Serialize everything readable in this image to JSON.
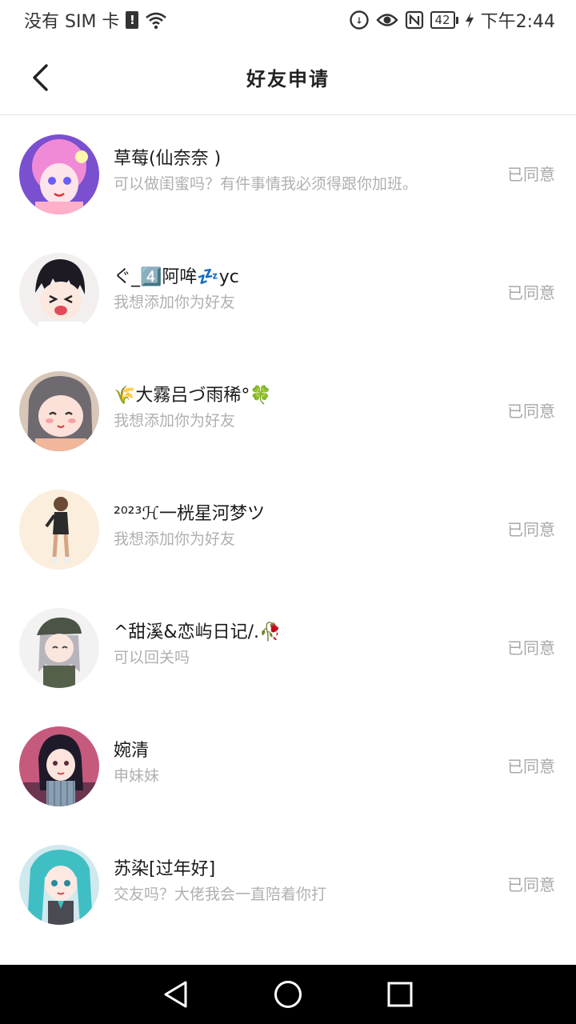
{
  "status_bar": {
    "carrier": "没有 SIM 卡",
    "sim_alert": "!",
    "battery": "42",
    "time": "下午2:44",
    "icons": [
      "sim-alert-icon",
      "wifi-icon",
      "data-saver-icon",
      "eye-icon",
      "nfc-icon",
      "battery-icon",
      "charging-icon"
    ]
  },
  "header": {
    "title": "好友申请",
    "back_icon": "back-arrow-icon"
  },
  "requests": [
    {
      "name": "草莓(仙奈奈 )",
      "message": "可以做闺蜜吗？有件事情我必须得跟你加班。",
      "status": "已同意",
      "avatar_color": "#e86fc6"
    },
    {
      "name": "ぐ_4️⃣阿哞💤yc",
      "message": "我想添加你为好友",
      "status": "已同意",
      "avatar_color": "#f2e9e6"
    },
    {
      "name": "🌾大霧吕づ雨稀°🍀",
      "message": "我想添加你为好友",
      "status": "已同意",
      "avatar_color": "#8f8a8c"
    },
    {
      "name": "²⁰²³ℋ一桄星河梦ツ",
      "message": "我想添加你为好友",
      "status": "已同意",
      "avatar_color": "#fbeedd"
    },
    {
      "name": "^甜溪&恋屿日记/.🥀",
      "message": "可以回关吗",
      "status": "已同意",
      "avatar_color": "#eeeeee"
    },
    {
      "name": "婉清",
      "message": "申妹妹",
      "status": "已同意",
      "avatar_color": "#c65a7c"
    },
    {
      "name": "苏染[过年好]",
      "message": "交友吗？大佬我会一直陪着你打",
      "status": "已同意",
      "avatar_color": "#6fc0c7"
    }
  ],
  "nav": {
    "back": "nav-back-icon",
    "home": "nav-home-icon",
    "recents": "nav-recents-icon"
  }
}
